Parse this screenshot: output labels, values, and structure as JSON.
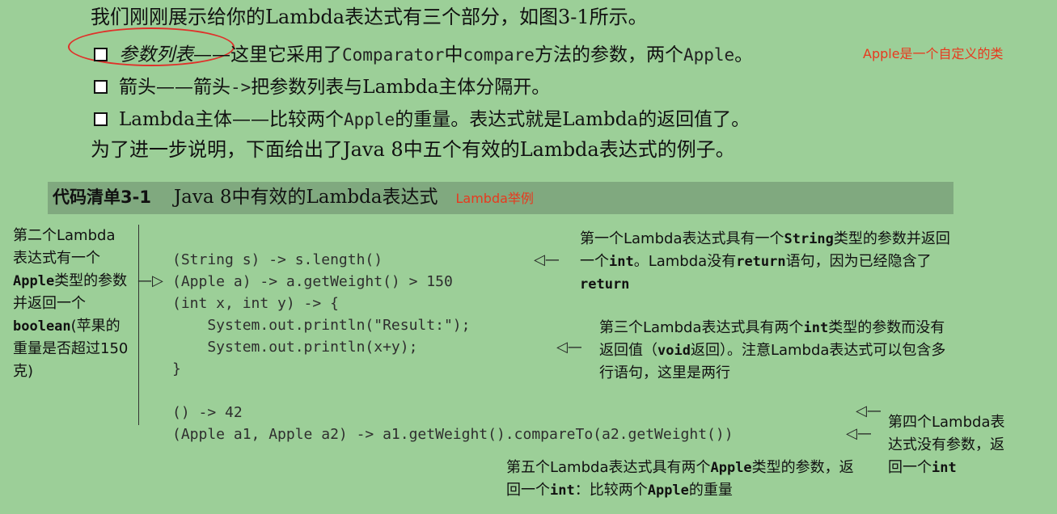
{
  "intro": {
    "line1": "我们刚刚展示给你的Lambda表达式有三个部分，如图3-1所示。",
    "bullet1": {
      "term": "参数列表",
      "dash": "——这里它采用了",
      "code1": "Comparator",
      "mid": "中",
      "code2": "compare",
      "rest": "方法的参数，两个",
      "code3": "Apple",
      "end": "。",
      "note": "Apple是一个自定义的类"
    },
    "bullet2": {
      "term": "箭头",
      "dash": "——箭头",
      "code": "->",
      "rest": "把参数列表与Lambda主体分隔开。"
    },
    "bullet3": {
      "term": "Lambda主体",
      "dash": "——比较两个",
      "code": "Apple",
      "rest": "的重量。表达式就是Lambda的返回值了。"
    },
    "line5": "为了进一步说明，下面给出了Java 8中五个有效的Lambda表达式的例子。"
  },
  "listing": {
    "number": "代码清单3-1",
    "title": "Java 8中有效的Lambda表达式",
    "note": "Lambda举例"
  },
  "code_lines": [
    "(String s) -> s.length()",
    "(Apple a) -> a.getWeight() > 150",
    "(int x, int y) -> {",
    "    System.out.println(\"Result:\");",
    "    System.out.println(x+y);",
    "}",
    "",
    "() -> 42",
    "(Apple a1, Apple a2) -> a1.getWeight().compareTo(a2.getWeight())"
  ],
  "annotations": {
    "second": {
      "p1": "第二个Lambda表达式有一个",
      "c1": "Apple",
      "p2": "类型的参数并返回一个",
      "c2": "boolean",
      "p3": "(苹果的重量是否超过150克)"
    },
    "first": {
      "p1": "第一个Lambda表达式具有一个",
      "c1": "String",
      "p2": "类型的参数并返回一个",
      "c2": "int",
      "p3": "。Lambda没有",
      "c3": "return",
      "p4": "语句，因为已经隐含了",
      "c4": "return"
    },
    "third": {
      "p1": "第三个Lambda表达式具有两个",
      "c1": "int",
      "p2": "类型的参数而没有返回值（",
      "c2": "void",
      "p3": "返回）。注意Lambda表达式可以包含多行语句，这里是两行"
    },
    "fourth": {
      "p1": "第四个Lambda表达式没有参数，返回一个",
      "c1": "int"
    },
    "fifth": {
      "p1": "第五个Lambda表达式具有两个",
      "c1": "Apple",
      "p2": "类型的参数，返回一个",
      "c2": "int",
      "p3": "：比较两个",
      "c3": "Apple",
      "p4": "的重量"
    }
  },
  "arrows": {
    "left": "—▷",
    "right": "◁—",
    "right_short": "◁—"
  }
}
